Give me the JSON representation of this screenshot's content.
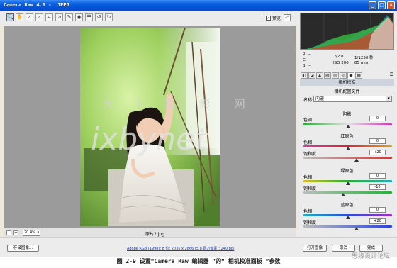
{
  "window": {
    "title": "Camera Raw 4.0 -  JPEG"
  },
  "toolbar": {
    "tools": [
      {
        "icon": "zoom-icon",
        "glyph": "🔍"
      },
      {
        "icon": "hand-icon",
        "glyph": "✋"
      },
      {
        "icon": "white-balance-icon",
        "glyph": "⁄"
      },
      {
        "icon": "color-sampler-icon",
        "glyph": "⁄"
      },
      {
        "icon": "crop-icon",
        "glyph": "⌗"
      },
      {
        "icon": "straighten-icon",
        "glyph": "⊿"
      },
      {
        "icon": "retouch-icon",
        "glyph": "✎"
      },
      {
        "icon": "red-eye-icon",
        "glyph": "◉"
      },
      {
        "icon": "preferences-icon",
        "glyph": "☰"
      },
      {
        "icon": "rotate-left-icon",
        "glyph": "↺"
      },
      {
        "icon": "rotate-right-icon",
        "glyph": "↻"
      }
    ],
    "preview_label": "预览",
    "preview_checked": true
  },
  "watermark": {
    "line1": "大 ⅼ 摄 影 网",
    "line2": "ixbynet"
  },
  "status": {
    "zoom": "20.4%",
    "filename": "原片2.jpg"
  },
  "bottom": {
    "save_label": "存储图像...",
    "info_link": "Adobe RGB (1998); 8 位; 2035 x 2866 (5.8 百万像素); 240 ppi",
    "open_label": "打开图像",
    "cancel_label": "取消",
    "done_label": "完成"
  },
  "histogram_info": {
    "r": "R:  ---",
    "g": "G:  ---",
    "b": "B:  ---",
    "aperture": "f/2.8",
    "shutter": "1/1250 秒",
    "iso": "ISO 200",
    "focal": "85 mm"
  },
  "panel": {
    "title": "相机校准",
    "subtitle": "相机配置文件",
    "name_label": "名称:",
    "name_value": "内嵌",
    "shadows": {
      "title": "阴影",
      "tint_label": "色调",
      "tint_value": "0",
      "tint_pos": 0.5
    },
    "red": {
      "title": "红原色",
      "hue_label": "色相",
      "hue_value": "0",
      "hue_pos": 0.5,
      "sat_label": "饱和度",
      "sat_value": "+20",
      "sat_pos": 0.6
    },
    "green": {
      "title": "绿原色",
      "hue_label": "色相",
      "hue_value": "0",
      "hue_pos": 0.5,
      "sat_label": "饱和度",
      "sat_value": "-10",
      "sat_pos": 0.45
    },
    "blue": {
      "title": "蓝原色",
      "hue_label": "色相",
      "hue_value": "0",
      "hue_pos": 0.5,
      "sat_label": "饱和度",
      "sat_value": "+20",
      "sat_pos": 0.6
    }
  },
  "caption": {
    "text": "图 2-9  设置“Camera Raw 编辑器 ”的“ 相机校准面板 ”参数",
    "site": "思缘设计论坛"
  }
}
